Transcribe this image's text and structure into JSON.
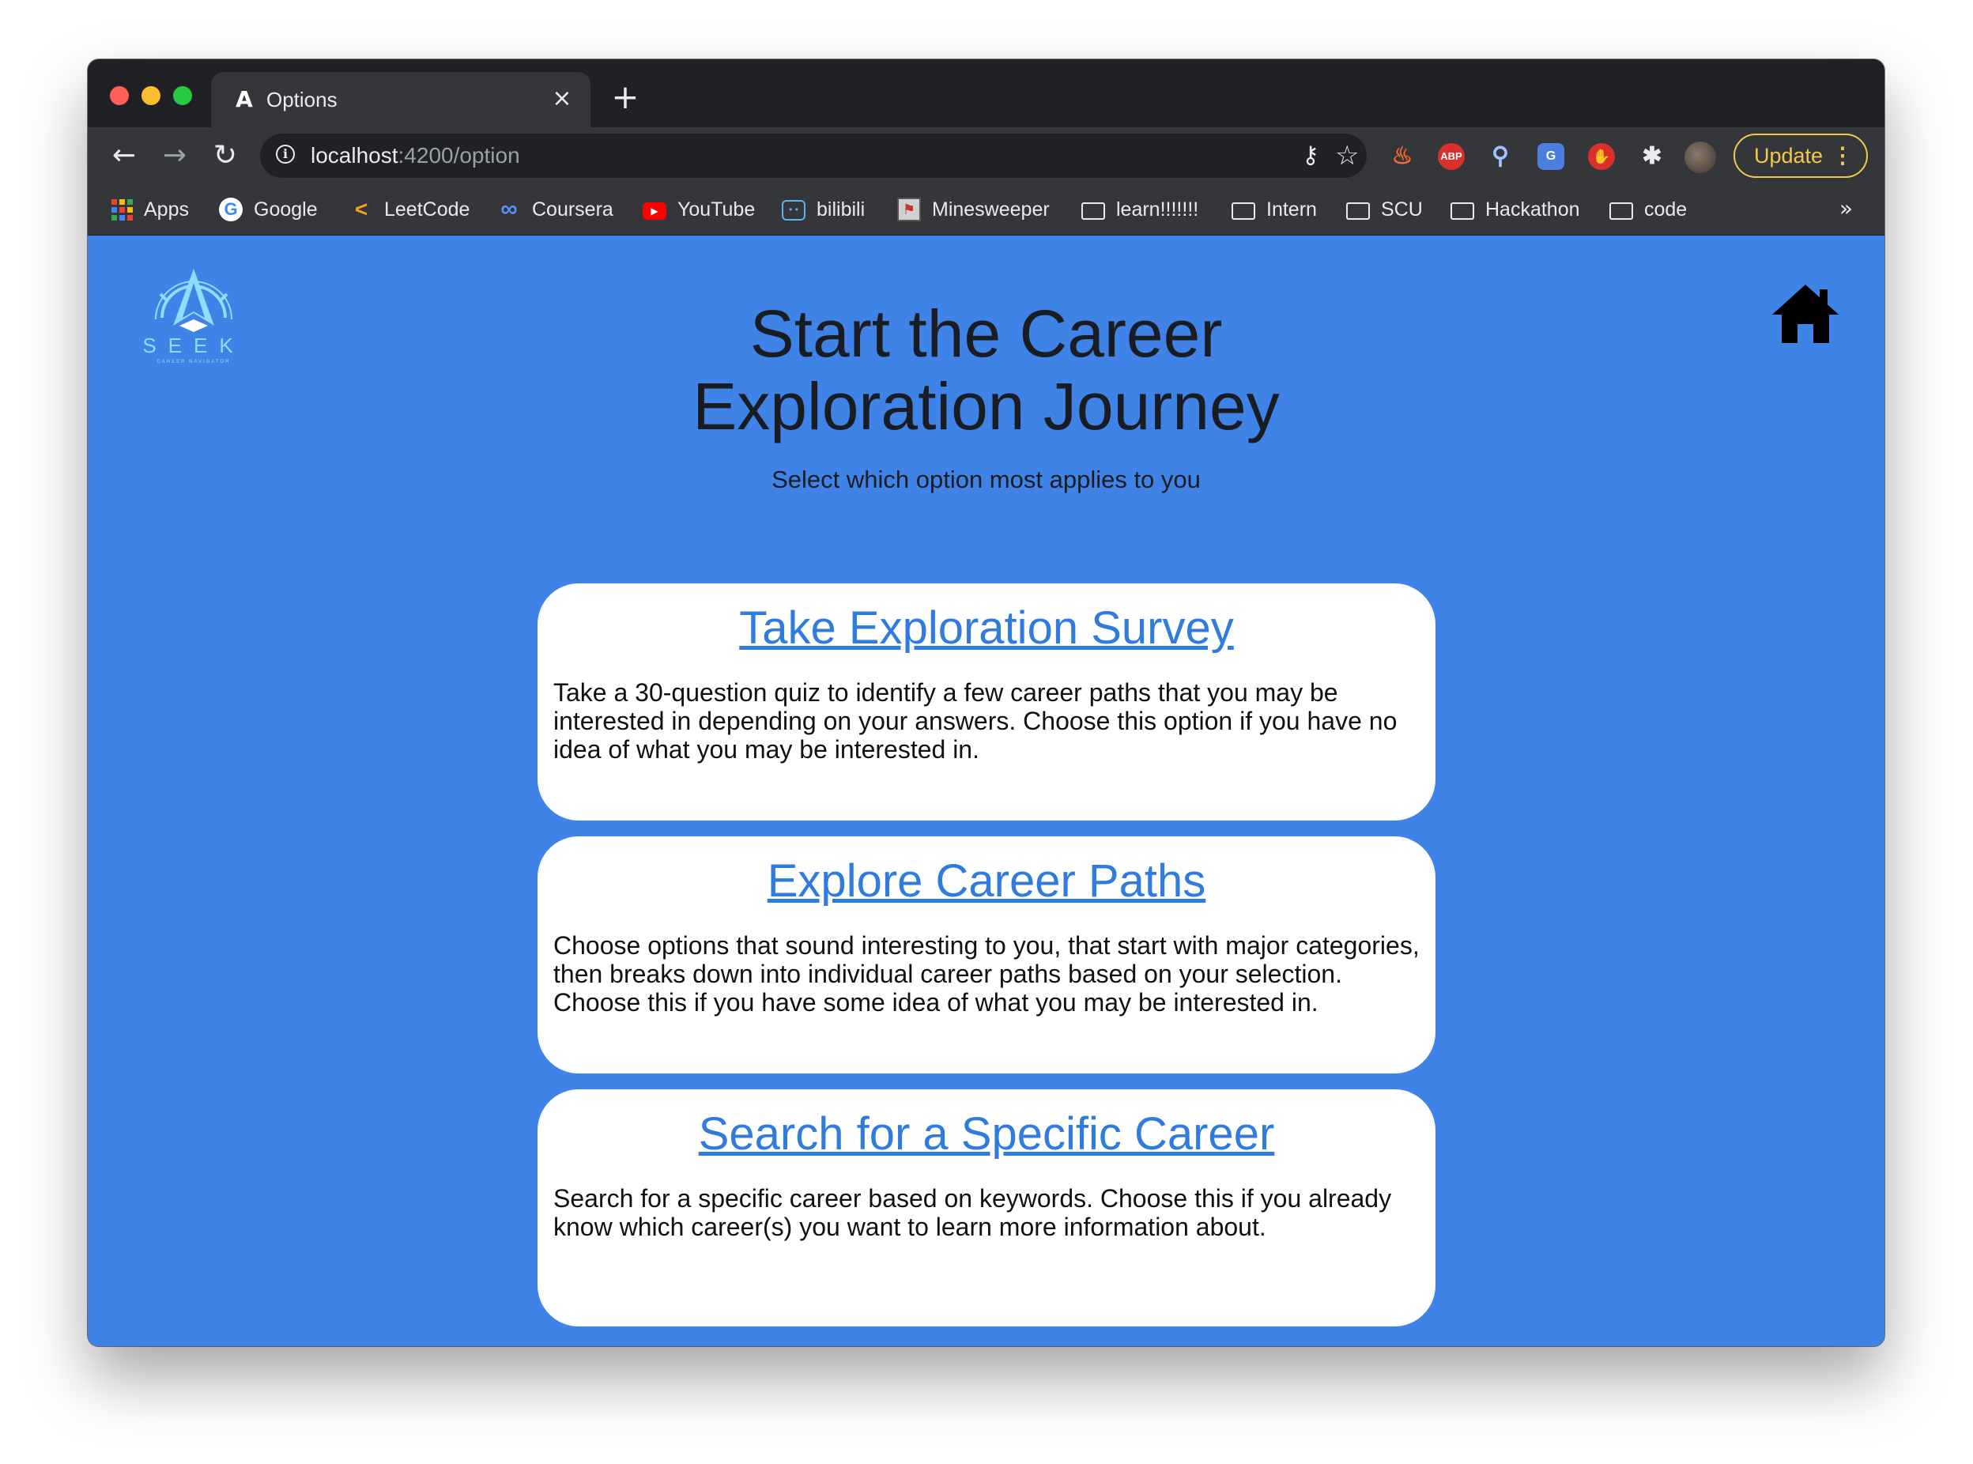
{
  "browser": {
    "tab_title": "Options",
    "url_host": "localhost",
    "url_path": ":4200/option",
    "update_label": "Update",
    "bookmarks": [
      {
        "label": "Apps",
        "icon": "apps-grid-icon"
      },
      {
        "label": "Google",
        "icon": "google-icon"
      },
      {
        "label": "LeetCode",
        "icon": "leetcode-icon"
      },
      {
        "label": "Coursera",
        "icon": "coursera-icon"
      },
      {
        "label": "YouTube",
        "icon": "youtube-icon"
      },
      {
        "label": "bilibili",
        "icon": "bilibili-icon"
      },
      {
        "label": "Minesweeper",
        "icon": "minesweeper-icon"
      },
      {
        "label": "learn!!!!!!!",
        "icon": "folder-icon"
      },
      {
        "label": "Intern",
        "icon": "folder-icon"
      },
      {
        "label": "SCU",
        "icon": "folder-icon"
      },
      {
        "label": "Hackathon",
        "icon": "folder-icon"
      },
      {
        "label": "code",
        "icon": "folder-icon"
      }
    ]
  },
  "colors": {
    "page_background": "#3f83e6",
    "link": "#2f7bde",
    "card_background": "#ffffff",
    "update_accent": "#f2c94c"
  },
  "page": {
    "logo_text": "SEEK",
    "logo_tagline": "CAREER NAVIGATOR",
    "title_line1": "Start the Career",
    "title_line2": "Exploration Journey",
    "subtitle": "Select which option most applies to you",
    "options": [
      {
        "title": "Take Exploration Survey",
        "description": "Take a 30-question quiz to identify a few career paths that you may be interested in depending on your answers. Choose this option if you have no idea of what you may be interested in."
      },
      {
        "title": "Explore Career Paths",
        "description": "Choose options that sound interesting to you, that start with major categories, then breaks down into individual career paths based on your selection. Choose this if you have some idea of what you may be interested in."
      },
      {
        "title": "Search for a Specific Career",
        "description": "Search for a specific career based on keywords. Choose this if you already know which career(s) you want to learn more information about."
      }
    ]
  }
}
